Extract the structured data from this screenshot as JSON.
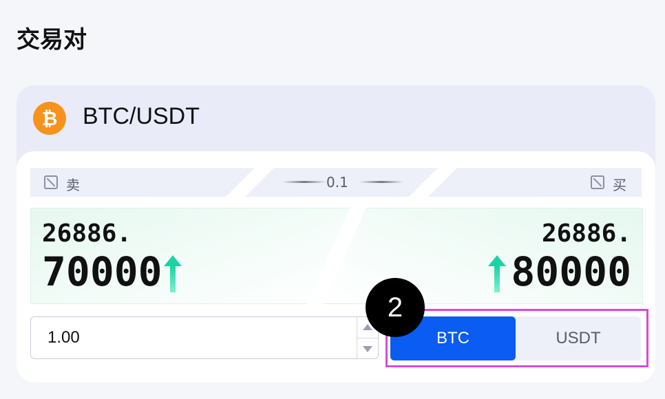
{
  "page": {
    "title": "交易对"
  },
  "pair": {
    "coin_symbol": "₿",
    "name": "BTC/USDT"
  },
  "orderbook": {
    "sell_label": "卖",
    "buy_label": "买",
    "step": "0.1",
    "sell_price_top": "26886.",
    "sell_price_bottom": "70000",
    "buy_price_top": "26886.",
    "buy_price_bottom": "80000"
  },
  "quantity": {
    "value": "1.00"
  },
  "unit_toggle": {
    "options": [
      "BTC",
      "USDT"
    ],
    "selected": "BTC"
  },
  "annotation": {
    "step_number": "2"
  },
  "colors": {
    "accent": "#0a5cf2",
    "up": "#1ed3a2",
    "highlight": "#d64bd6",
    "coin": "#f7931a"
  }
}
